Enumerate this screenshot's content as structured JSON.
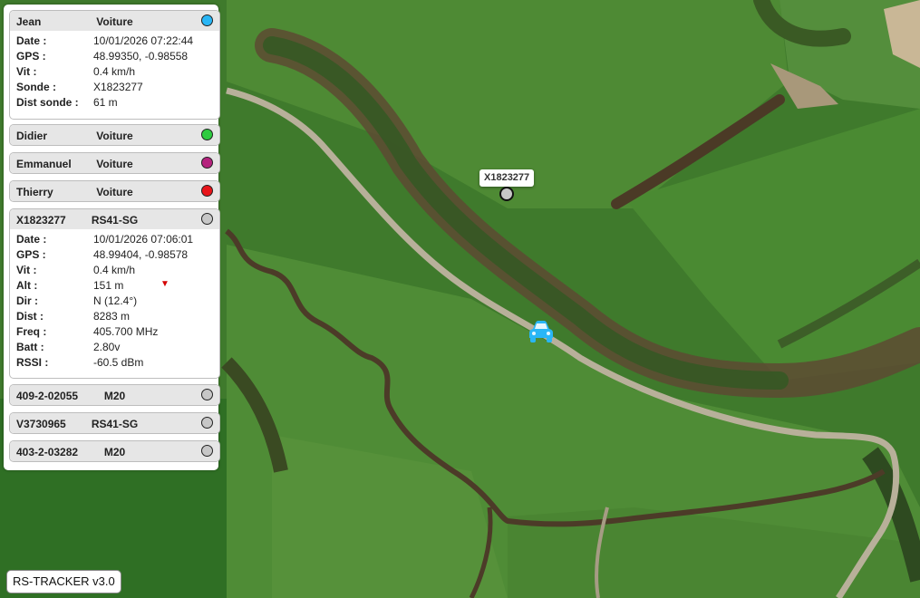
{
  "app": {
    "version_label": "RS-TRACKER v3.0"
  },
  "map": {
    "probe_label": "X1823277"
  },
  "colors": {
    "jean": "#29b6f6",
    "didier": "#2ecc40",
    "emmanuel": "#b5237e",
    "thierry": "#e8141a",
    "probe": "#c7c7c7",
    "car": "#29b6f6",
    "descending_arrow": "#d40000"
  },
  "cards": {
    "jean": {
      "name": "Jean",
      "kind": "Voiture",
      "rows": [
        {
          "label": "Date :",
          "value": "10/01/2026 07:22:44"
        },
        {
          "label": "GPS :",
          "value": "48.99350, -0.98558"
        },
        {
          "label": "Vit :",
          "value": "0.4 km/h"
        },
        {
          "label": "Sonde :",
          "value": "X1823277"
        },
        {
          "label": "Dist sonde :",
          "value": "61 m"
        }
      ]
    },
    "didier": {
      "name": "Didier",
      "kind": "Voiture"
    },
    "emmanuel": {
      "name": "Emmanuel",
      "kind": "Voiture"
    },
    "thierry": {
      "name": "Thierry",
      "kind": "Voiture"
    },
    "probe1": {
      "name": "X1823277",
      "kind": "RS41-SG",
      "rows": [
        {
          "label": "Date :",
          "value": "10/01/2026 07:06:01"
        },
        {
          "label": "GPS :",
          "value": "48.99404, -0.98578"
        },
        {
          "label": "Vit :",
          "value": "0.4 km/h"
        },
        {
          "label": "Alt :",
          "value": "151 m",
          "arrow": "▼"
        },
        {
          "label": "Dir :",
          "value": "N (12.4°)"
        },
        {
          "label": "Dist :",
          "value": "8283 m"
        },
        {
          "label": "Freq :",
          "value": "405.700 MHz"
        },
        {
          "label": "Batt :",
          "value": "2.80v"
        },
        {
          "label": "RSSI :",
          "value": "-60.5 dBm"
        }
      ]
    },
    "probe2": {
      "name": "409-2-02055",
      "kind": "M20"
    },
    "probe3": {
      "name": "V3730965",
      "kind": "RS41-SG"
    },
    "probe4": {
      "name": "403-2-03282",
      "kind": "M20"
    }
  }
}
